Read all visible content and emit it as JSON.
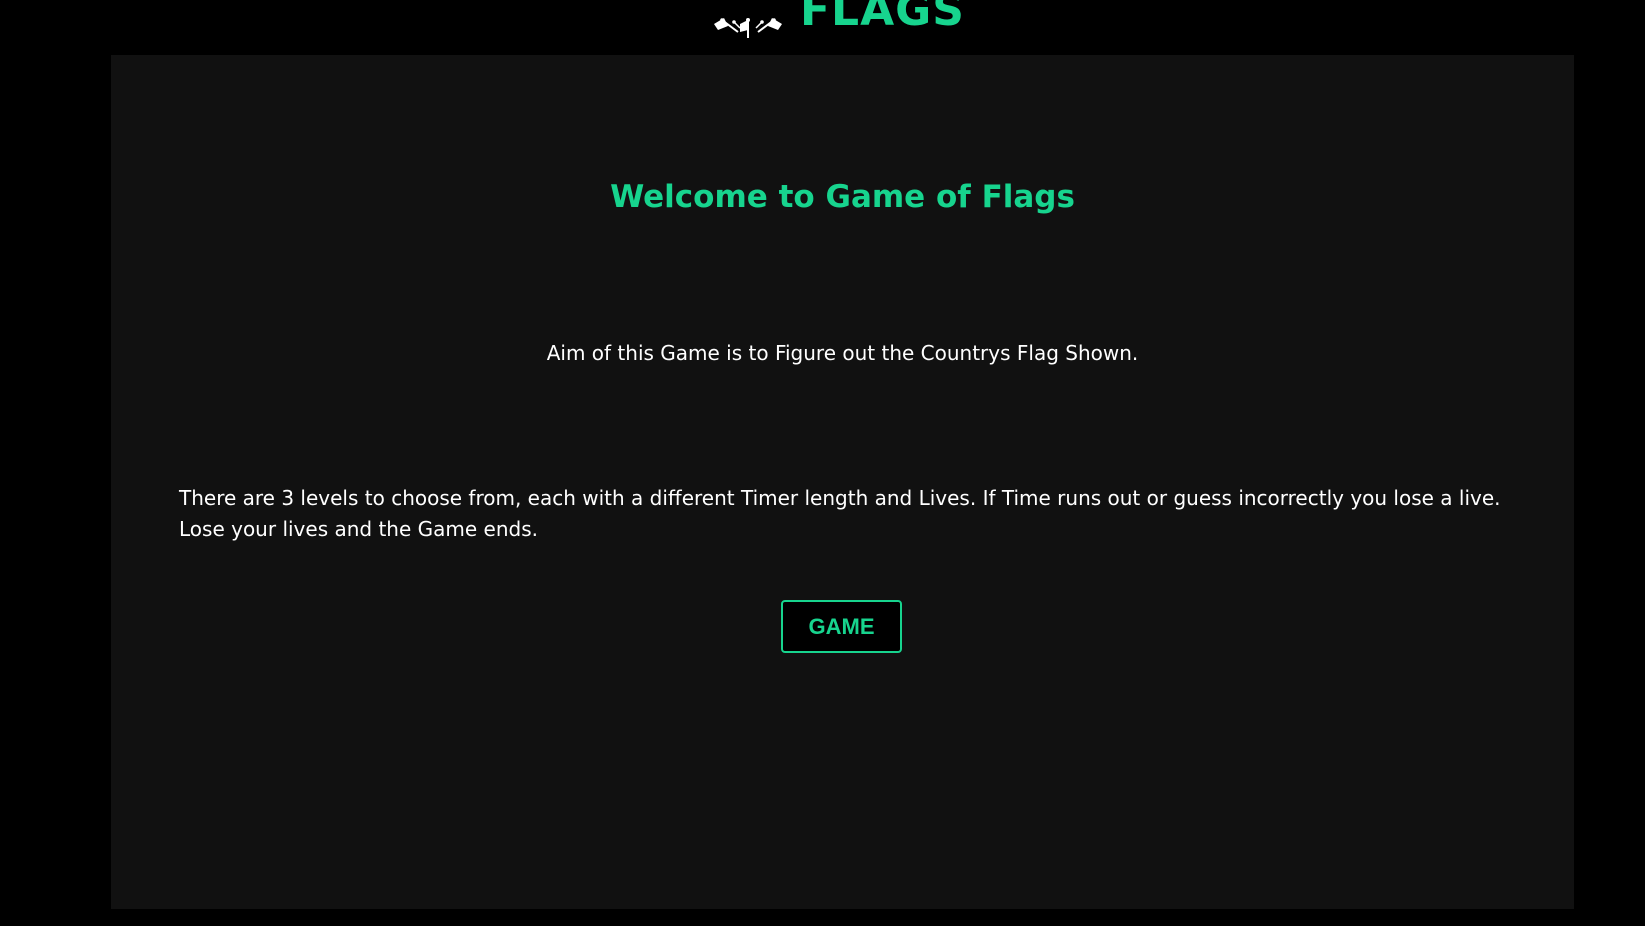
{
  "header": {
    "logo_text": "FLAGS",
    "logo_icon": "crossed-flags-logo-icon"
  },
  "main": {
    "title": "Welcome to Game of Flags",
    "aim_text": "Aim of this Game is to Figure out the Countrys Flag Shown.",
    "levels_text": "There are 3 levels to choose from, each with a different Timer length and Lives. If Time runs out or guess incorrectly you lose a live. Lose your lives and the Game ends.",
    "game_button_label": "GAME"
  },
  "colors": {
    "page_background": "#000000",
    "panel_background": "#111111",
    "accent": "#17d48e",
    "text": "#ffffff"
  }
}
